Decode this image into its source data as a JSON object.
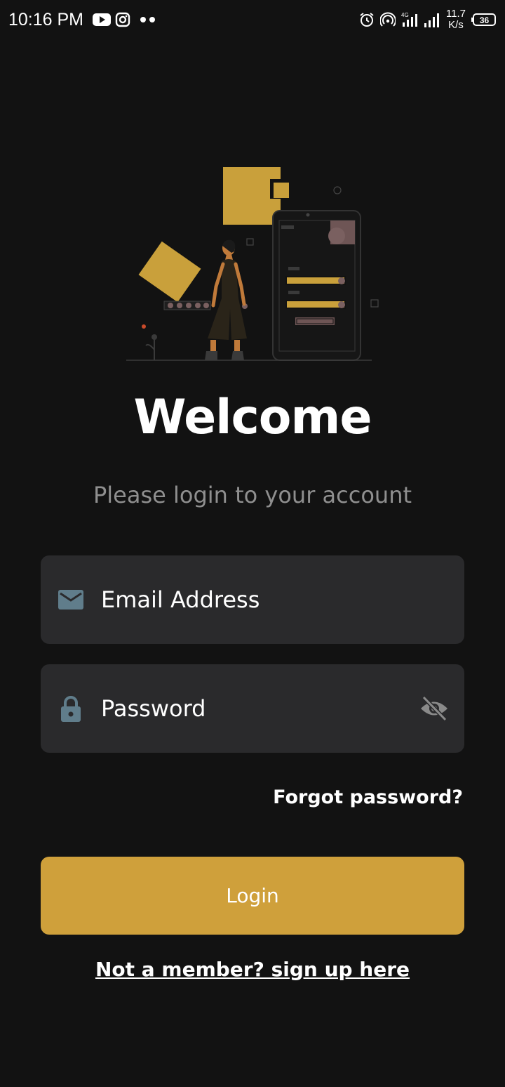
{
  "status_bar": {
    "time": "10:16 PM",
    "network_speed_value": "11.7",
    "network_speed_unit": "K/s",
    "battery_level": "36",
    "network_type": "4G",
    "icons": [
      "youtube-icon",
      "instagram-icon",
      "alarm-icon",
      "hotspot-icon",
      "signal-icon",
      "battery-icon"
    ]
  },
  "welcome_title": "Welcome",
  "subtitle": "Please login to your account",
  "form": {
    "email_placeholder": "Email Address",
    "email_value": "",
    "password_placeholder": "Password",
    "password_value": "",
    "email_icon": "mail-icon",
    "password_icon": "lock-icon",
    "visibility_icon": "eye-off-icon"
  },
  "forgot_password_label": "Forgot password?",
  "login_button_label": "Login",
  "signup_link_label": "Not a member? sign up here",
  "colors": {
    "background": "#121212",
    "field_background": "#2a2a2c",
    "accent": "#cfa03b",
    "icon_color": "#607d8b",
    "subtitle": "#8f8f8f"
  }
}
